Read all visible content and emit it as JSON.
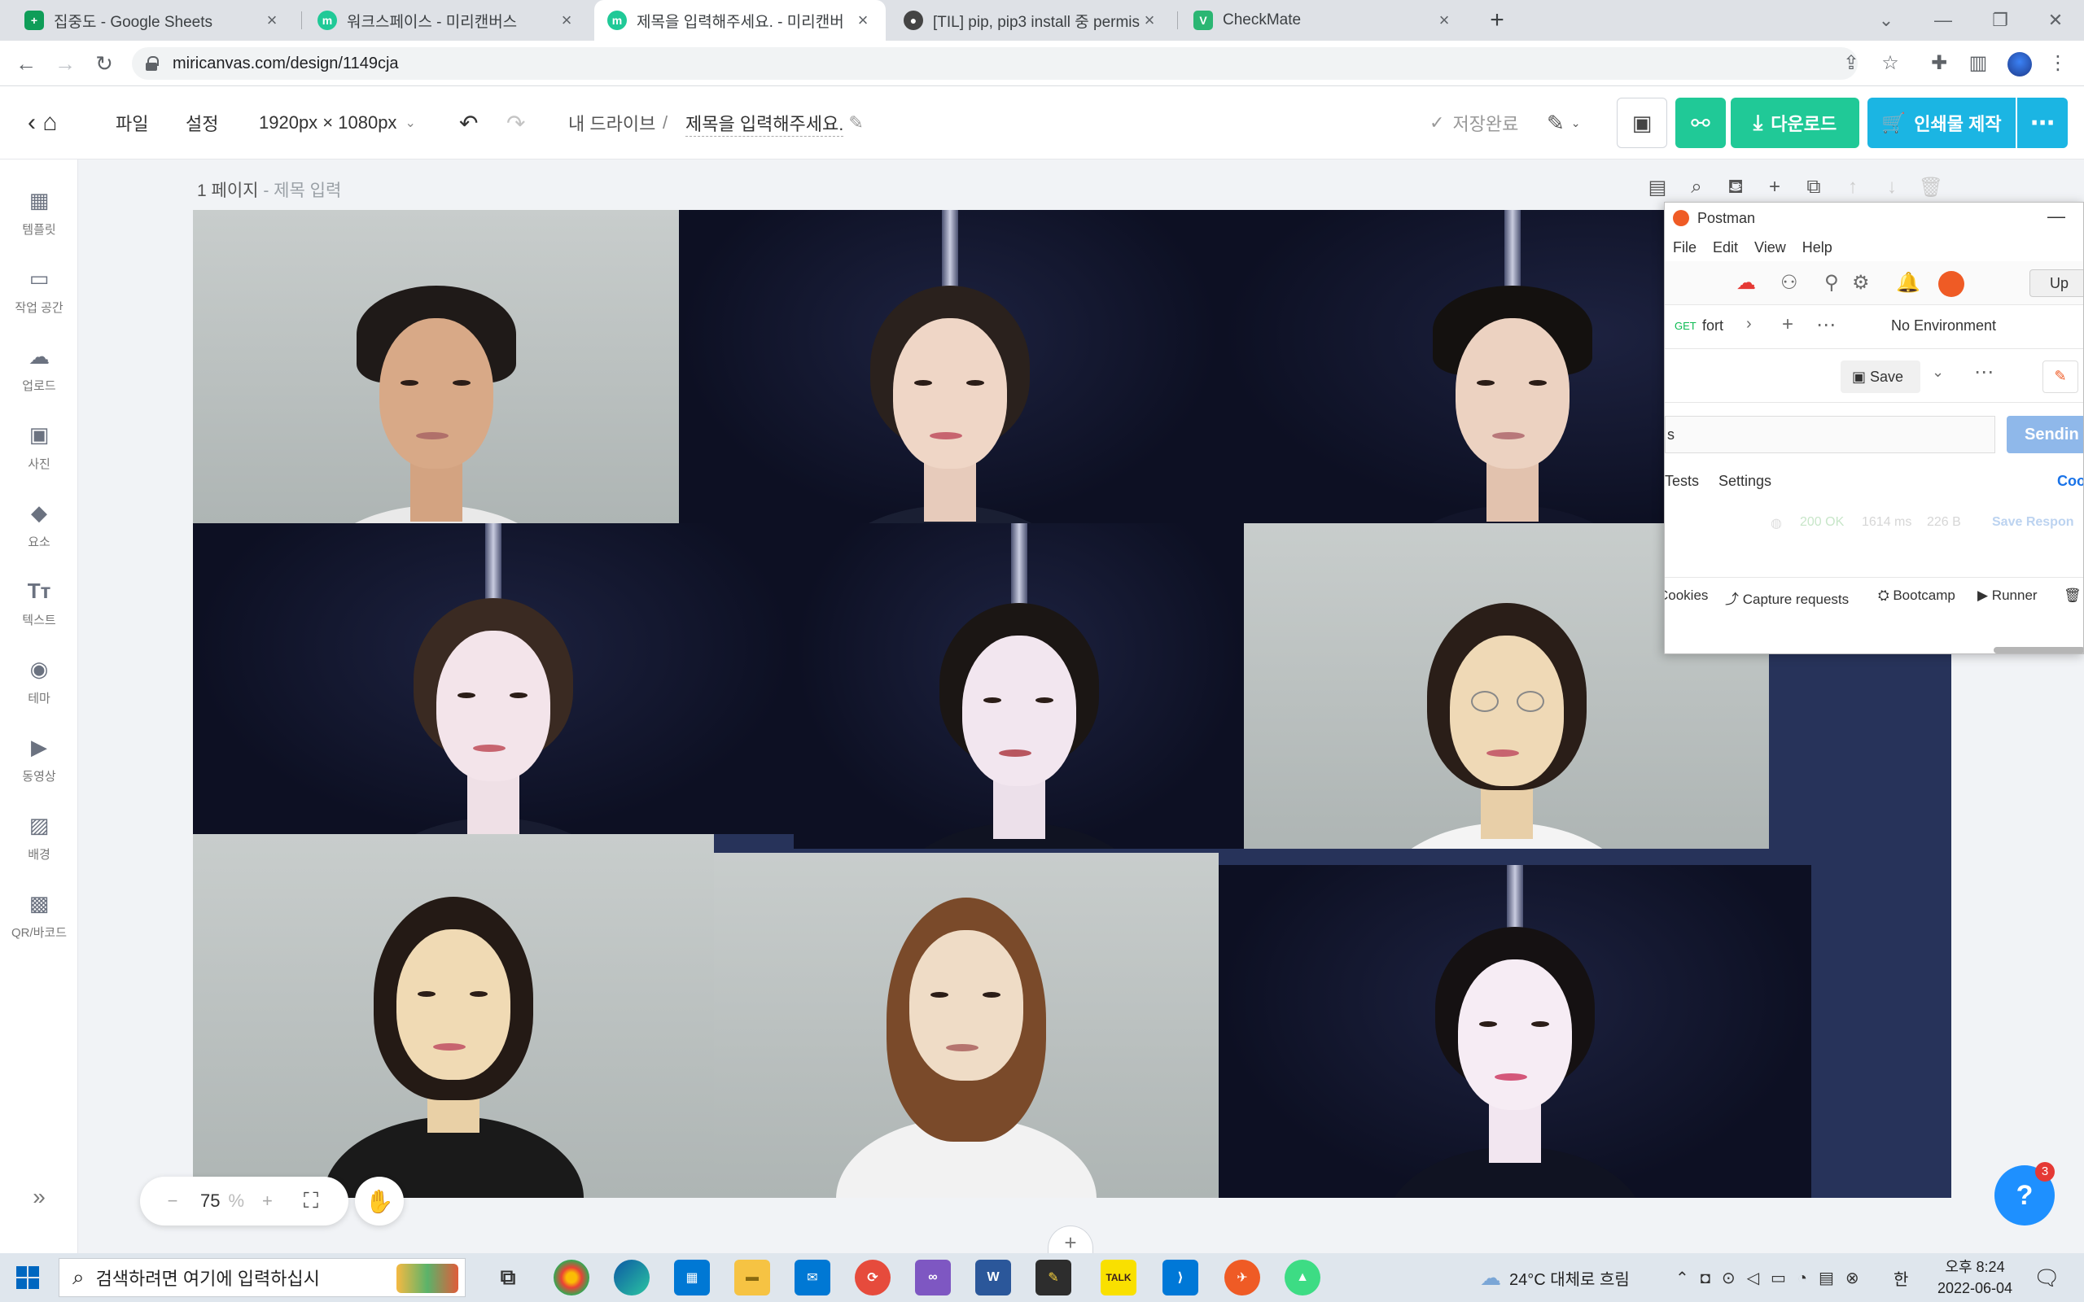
{
  "browser": {
    "tabs": [
      {
        "title": "집중도 - Google Sheets",
        "favicon_color": "#0f9d58",
        "favicon_glyph": "+"
      },
      {
        "title": "워크스페이스 - 미리캔버스",
        "favicon_color": "#20c997",
        "favicon_glyph": "m"
      },
      {
        "title": "제목을 입력해주세요. - 미리캔버",
        "favicon_color": "#20c997",
        "favicon_glyph": "m"
      },
      {
        "title": "[TIL] pip, pip3 install 중 permiss",
        "favicon_color": "#444444",
        "favicon_glyph": "●"
      },
      {
        "title": "CheckMate",
        "favicon_color": "#2bb673",
        "favicon_glyph": "V"
      }
    ],
    "url": "miricanvas.com/design/1149cja"
  },
  "editor": {
    "menu_file": "파일",
    "menu_settings": "설정",
    "size": "1920px × 1080px",
    "breadcrumb_root": "내 드라이브",
    "breadcrumb_sep": "/",
    "doc_title": "제목을 입력해주세요.",
    "save_status": "저장완료",
    "download_label": "다운로드",
    "print_label": "인쇄물 제작",
    "download_color": "#20c997",
    "print_color": "#1bb5e3",
    "share_color": "#20c997",
    "page_label": "1 페이지",
    "page_sep": " - ",
    "page_title_placeholder": "제목 입력",
    "zoom": "75",
    "zoom_unit": "%"
  },
  "sidebar": {
    "items": [
      {
        "label": "템플릿",
        "icon": "template-icon"
      },
      {
        "label": "작업 공간",
        "icon": "workspace-icon"
      },
      {
        "label": "업로드",
        "icon": "upload-icon"
      },
      {
        "label": "사진",
        "icon": "photo-icon"
      },
      {
        "label": "요소",
        "icon": "elements-icon"
      },
      {
        "label": "텍스트",
        "icon": "text-icon"
      },
      {
        "label": "테마",
        "icon": "palette-icon"
      },
      {
        "label": "동영상",
        "icon": "video-icon"
      },
      {
        "label": "배경",
        "icon": "background-icon"
      },
      {
        "label": "QR/바코드",
        "icon": "qr-icon"
      }
    ]
  },
  "help": {
    "badge": "3"
  },
  "postman": {
    "title": "Postman",
    "menu": [
      "File",
      "Edit",
      "View",
      "Help"
    ],
    "upgrade": "Up",
    "method": "GET",
    "request_name": "fort",
    "environment": "No Environment",
    "save_label": "Save",
    "url_fragment": "s",
    "send_label": "Sendin",
    "tab_tests": "Tests",
    "tab_settings": "Settings",
    "tab_cookies": "Coo",
    "status": "200 OK",
    "time": "1614 ms",
    "size": "226 B",
    "save_response": "Save Respon",
    "footer": [
      "Cookies",
      "Capture requests",
      "Bootcamp",
      "Runner"
    ]
  },
  "taskbar": {
    "search_placeholder": "검색하려면 여기에 입력하십시",
    "weather": "24°C 대체로 흐림",
    "ime": "한",
    "time": "오후 8:24",
    "date": "2022-06-04"
  }
}
